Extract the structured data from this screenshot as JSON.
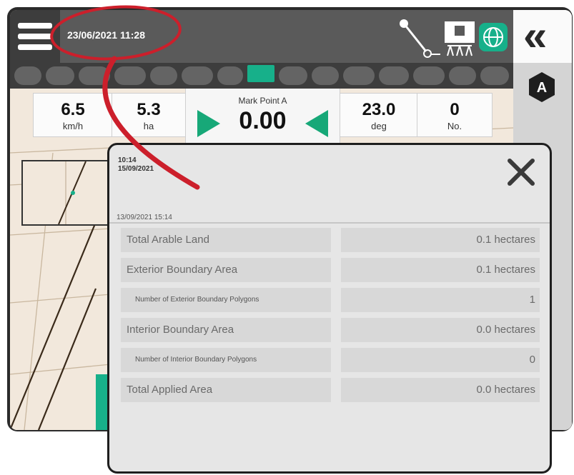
{
  "topbar": {
    "datetime": "23/06/2021 11:28",
    "menu_icon": "hamburger-menu-icon",
    "icons": [
      "steering-icon",
      "boom-sections-icon",
      "gnss-status-icon"
    ]
  },
  "sidebar": {
    "collapse_glyph": "«",
    "badge": "A"
  },
  "infobar": {
    "speed": {
      "value": "6.5",
      "unit": "km/h"
    },
    "area": {
      "value": "5.3",
      "unit": "ha"
    },
    "mark_point": {
      "label": "Mark Point A",
      "value": "0.00"
    },
    "heading": {
      "value": "23.0",
      "unit": "deg"
    },
    "count": {
      "value": "0",
      "unit": "No."
    }
  },
  "dialog": {
    "time": "10:14",
    "date": "15/09/2021",
    "subtitle": "13/09/2021 15:14",
    "rows": [
      {
        "label": "Total Arable Land",
        "value": "0.1 hectares"
      },
      {
        "label": "Exterior Boundary Area",
        "value": "0.1 hectares"
      },
      {
        "label": "Number of Exterior Boundary Polygons",
        "value": "1"
      },
      {
        "label": "Interior Boundary Area",
        "value": "0.0 hectares"
      },
      {
        "label": "Number of Interior Boundary Polygons",
        "value": "0"
      },
      {
        "label": "Total Applied Area",
        "value": "0.0 hectares"
      }
    ]
  },
  "colors": {
    "accent_green": "#17b08a",
    "callout_red": "#cc1f2b",
    "topbar": "#5a5a5a"
  }
}
